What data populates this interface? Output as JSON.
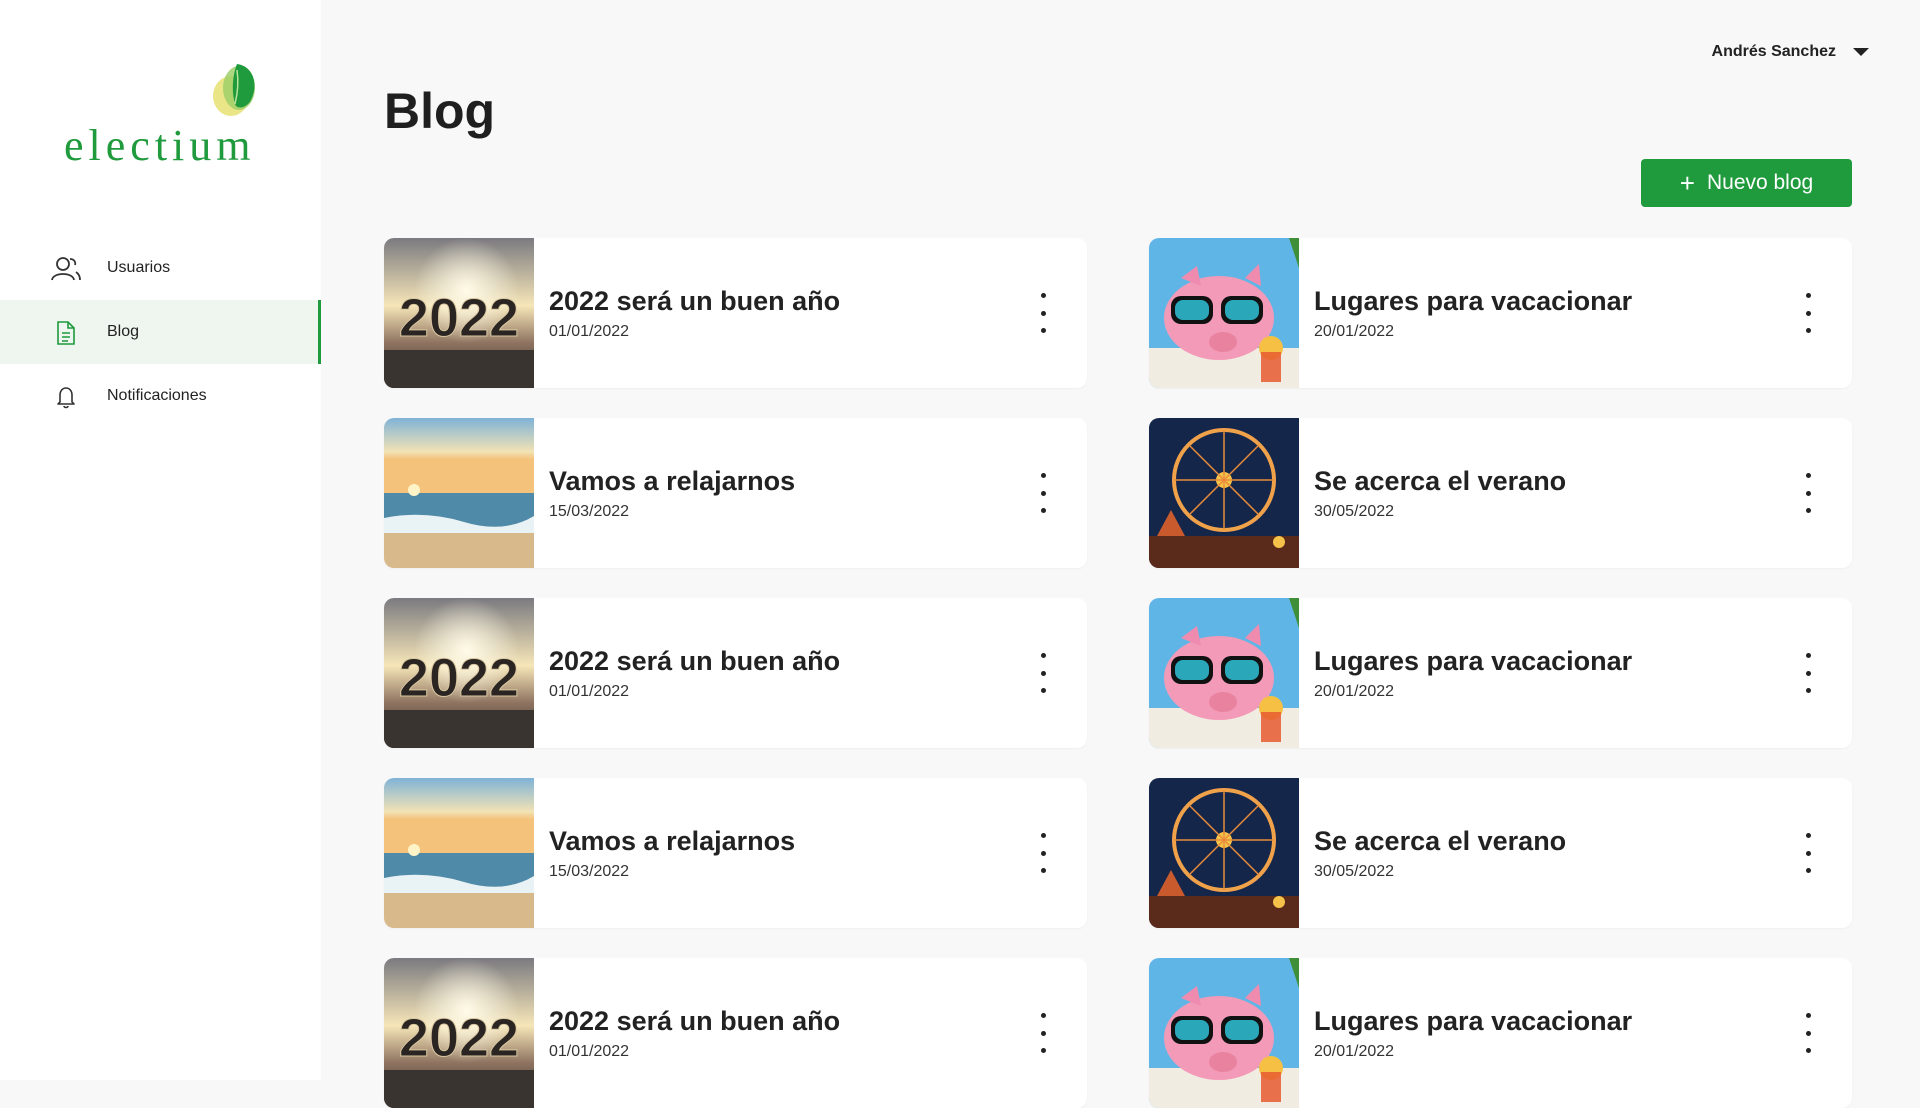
{
  "brand": {
    "name": "electium",
    "accent": "#1f9a3c"
  },
  "sidebar": {
    "items": [
      {
        "label": "Usuarios",
        "icon": "users-icon",
        "active": false
      },
      {
        "label": "Blog",
        "icon": "document-icon",
        "active": true
      },
      {
        "label": "Notificaciones",
        "icon": "bell-icon",
        "active": false
      }
    ]
  },
  "header": {
    "user_name": "Andrés Sanchez",
    "user_menu_icon": "caret-down-icon"
  },
  "page": {
    "title": "Blog",
    "new_button_label": "Nuevo blog"
  },
  "posts": [
    {
      "title": "2022 será un buen año",
      "date": "01/01/2022",
      "image": "new-year-2022-sunset"
    },
    {
      "title": "Lugares para vacacionar",
      "date": "20/01/2022",
      "image": "piggy-bank-sunglasses-beach"
    },
    {
      "title": "Vamos a relajarnos",
      "date": "15/03/2022",
      "image": "beach-sunset"
    },
    {
      "title": "Se acerca el verano",
      "date": "30/05/2022",
      "image": "ferris-wheel-night"
    },
    {
      "title": "2022 será un buen año",
      "date": "01/01/2022",
      "image": "new-year-2022-sunset"
    },
    {
      "title": "Lugares para vacacionar",
      "date": "20/01/2022",
      "image": "piggy-bank-sunglasses-beach"
    },
    {
      "title": "Vamos a relajarnos",
      "date": "15/03/2022",
      "image": "beach-sunset"
    },
    {
      "title": "Se acerca el verano",
      "date": "30/05/2022",
      "image": "ferris-wheel-night"
    },
    {
      "title": "2022 será un buen año",
      "date": "01/01/2022",
      "image": "new-year-2022-sunset"
    },
    {
      "title": "Lugares para vacacionar",
      "date": "20/01/2022",
      "image": "piggy-bank-sunglasses-beach"
    }
  ]
}
